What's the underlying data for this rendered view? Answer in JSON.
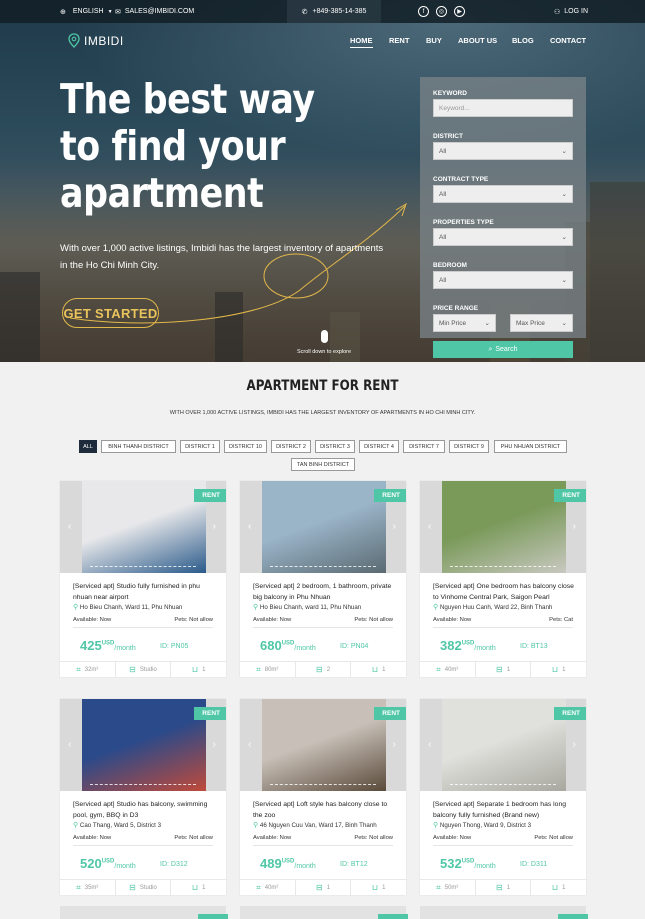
{
  "topbar": {
    "language": "ENGLISH",
    "email": "SALES@IMBIDI.COM",
    "phone": "+849-385-14-385",
    "social": [
      "f",
      "◎",
      "▶"
    ],
    "login": "LOG IN"
  },
  "brand": {
    "name": "IMBIDI"
  },
  "nav": [
    "HOME",
    "RENT",
    "BUY",
    "ABOUT US",
    "BLOG",
    "CONTACT"
  ],
  "hero": {
    "headline": "The best way to find your apartment",
    "subtitle": "With over 1,000 active listings, Imbidi has the largest inventory of apartments in the Ho Chi Minh City.",
    "cta": "GET STARTED",
    "scroll_hint": "Scroll down to explore"
  },
  "search": {
    "keyword_label": "KEYWORD",
    "keyword_placeholder": "Keyword...",
    "district_label": "DISTRICT",
    "district_value": "All",
    "contract_label": "CONTRACT TYPE",
    "contract_value": "All",
    "property_label": "PROPERTIES TYPE",
    "property_value": "All",
    "bedroom_label": "BEDROOM",
    "bedroom_value": "All",
    "price_label": "PRICE RANGE",
    "min_price": "Min Price",
    "max_price": "Max Price",
    "search_button": "Search"
  },
  "section": {
    "title": "APARTMENT FOR RENT",
    "subtitle": "WITH OVER 1,000 ACTIVE LISTINGS, IMBIDI HAS THE LARGEST INVENTORY OF APARTMENTS IN HO CHI MINH CITY."
  },
  "filters": [
    "ALL",
    "BINH THANH DISTRICT",
    "DISTRICT 1",
    "DISTRICT 10",
    "DISTRICT 2",
    "DISTRICT 3",
    "DISTRICT 4",
    "DISTRICT 7",
    "DISTRICT 9",
    "PHU NHUAN DISTRICT",
    "TAN BINH DISTRICT"
  ],
  "listings": [
    {
      "tag": "RENT",
      "title": "[Serviced apt] Studio fully furnished in phu nhuan near airport",
      "address": "Ho Bieu Chanh, Ward 11, Phu Nhuan",
      "available": "Available: Now",
      "pets": "Pets: Not allow",
      "price": "425",
      "currency": "USD",
      "per": "/month",
      "id": "ID: PN05",
      "area": "32m²",
      "beds": "Studio",
      "baths": "1",
      "colors": [
        "#e8e8ea",
        "#2a5a8a"
      ]
    },
    {
      "tag": "RENT",
      "title": "[Serviced apt] 2 bedroom, 1 bathroom, private big balcony in Phu Nhuan",
      "address": "Ho Bieu Chanh, ward 11, Phu Nhuan",
      "available": "Available: Now",
      "pets": "Pets: Not allow",
      "price": "680",
      "currency": "USD",
      "per": "/month",
      "id": "ID: PN04",
      "area": "80m²",
      "beds": "2",
      "baths": "1",
      "colors": [
        "#9ab4c8",
        "#5a6a72"
      ]
    },
    {
      "tag": "RENT",
      "title": "[Serviced apt] One bedroom has balcony close to Vinhome Central Park, Saigon Pearl",
      "address": "Nguyen Huu Canh, Ward 22, Binh Thanh",
      "available": "Available: Now",
      "pets": "Pets: Cat",
      "price": "382",
      "currency": "USD",
      "per": "/month",
      "id": "ID: BT13",
      "area": "40m²",
      "beds": "1",
      "baths": "1",
      "colors": [
        "#7a9a5a",
        "#c8c8c0"
      ]
    },
    {
      "tag": "RENT",
      "title": "[Serviced apt] Studio has balcony, swimming pool, gym, BBQ in D3",
      "address": "Cao Thang, Ward 5, District 3",
      "available": "Available: Now",
      "pets": "Pets: Not allow",
      "price": "520",
      "currency": "USD",
      "per": "/month",
      "id": "ID: D312",
      "area": "35m²",
      "beds": "Studio",
      "baths": "1",
      "colors": [
        "#2a4a8a",
        "#c04a3a"
      ]
    },
    {
      "tag": "RENT",
      "title": "[Serviced apt] Loft style has balcony close to the zoo",
      "address": "46 Nguyen Cuu Van, Ward 17, Binh Thanh",
      "available": "Available: Now",
      "pets": "Pets: Not allow",
      "price": "489",
      "currency": "USD",
      "per": "/month",
      "id": "ID: BT12",
      "area": "40m²",
      "beds": "1",
      "baths": "1",
      "colors": [
        "#c8c0b8",
        "#5a4a3a"
      ]
    },
    {
      "tag": "RENT",
      "title": "[Serviced apt] Separate 1 bedroom has long balcony fully furnished (Brand new)",
      "address": "Nguyen Thong, Ward 9, District 3",
      "available": "Available: Now",
      "pets": "Pets: Not allow",
      "price": "532",
      "currency": "USD",
      "per": "/month",
      "id": "ID: D311",
      "area": "50m²",
      "beds": "1",
      "baths": "1",
      "colors": [
        "#e0e0dc",
        "#a8a8a0"
      ]
    }
  ]
}
